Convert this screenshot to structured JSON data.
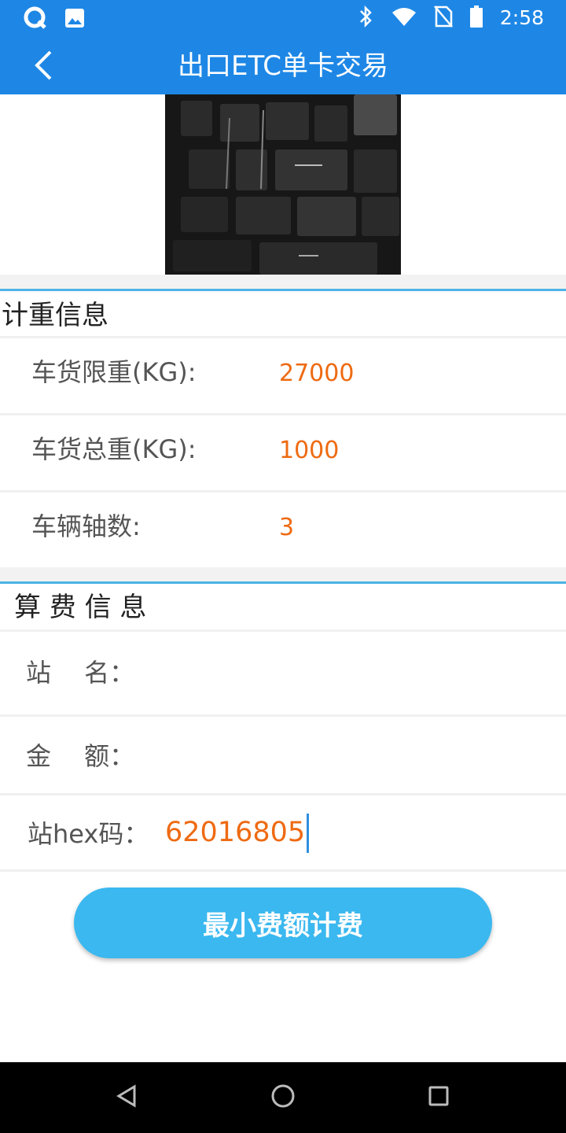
{
  "status_bar": {
    "time": "2:58",
    "left_icons": [
      "q-app-icon",
      "image-icon"
    ],
    "right_icons": [
      "bluetooth-icon",
      "wifi-icon",
      "no-sim-icon",
      "battery-icon"
    ]
  },
  "app_bar": {
    "title": "出口ETC单卡交易",
    "back_icon": "chevron-left-icon"
  },
  "weighing": {
    "title": "计重信息",
    "rows": [
      {
        "label": "车货限重(KG):",
        "value": "27000"
      },
      {
        "label": "车货总重(KG):",
        "value": "1000"
      },
      {
        "label": "车辆轴数:",
        "value": "3"
      }
    ]
  },
  "billing": {
    "title": "算 费 信 息",
    "station_label": "站　 名：",
    "station_value": "",
    "amount_label": "金　 额：",
    "amount_value": "",
    "hex_label": "站hex码：",
    "hex_value": "62016805"
  },
  "action_button": "最小费额计费",
  "nav_bar": {
    "icons": [
      "back-triangle-icon",
      "home-circle-icon",
      "recents-square-icon"
    ]
  },
  "colors": {
    "primary": "#1e87e6",
    "accent": "#ee6a12",
    "button": "#3bb8ef",
    "divider": "#4cb3e6"
  }
}
